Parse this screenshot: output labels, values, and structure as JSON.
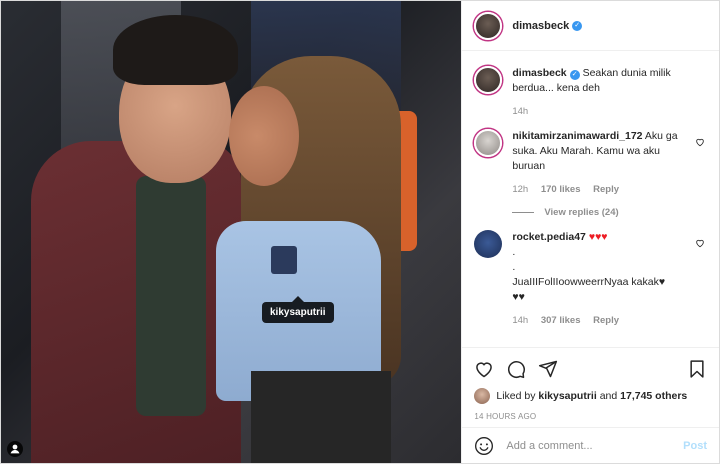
{
  "post": {
    "author": "dimasbeck",
    "photo_tag": "kikysaputrii"
  },
  "caption": {
    "username": "dimasbeck",
    "text": "Seakan dunia milik berdua... kena deh",
    "time": "14h"
  },
  "comments": [
    {
      "username": "nikitamirzanimawardi_172",
      "text": "Aku ga suka. Aku Marah. Kamu wa aku buruan",
      "time": "12h",
      "likes": "170 likes",
      "reply": "Reply",
      "view_replies": "View replies (24)"
    },
    {
      "username": "rocket.pedia47",
      "hearts": "♥♥♥",
      "text_line1": ".",
      "text_line2": ".",
      "text_line3": "JuaIIIFolIIoowweerrNyaa kakak♥",
      "text_line4": "♥♥",
      "time": "14h",
      "likes": "307 likes",
      "reply": "Reply"
    }
  ],
  "likes": {
    "prefix": "Liked by",
    "user": "kikysaputrii",
    "and": "and",
    "others": "17,745 others"
  },
  "timestamp": "14 HOURS AGO",
  "add_comment": {
    "placeholder": "Add a comment...",
    "post_label": "Post"
  },
  "colors": {
    "verified": "#3897f0",
    "muted": "#8e8e8e",
    "post_disabled": "#b2dffc",
    "heart_red": "#ed1c24"
  }
}
